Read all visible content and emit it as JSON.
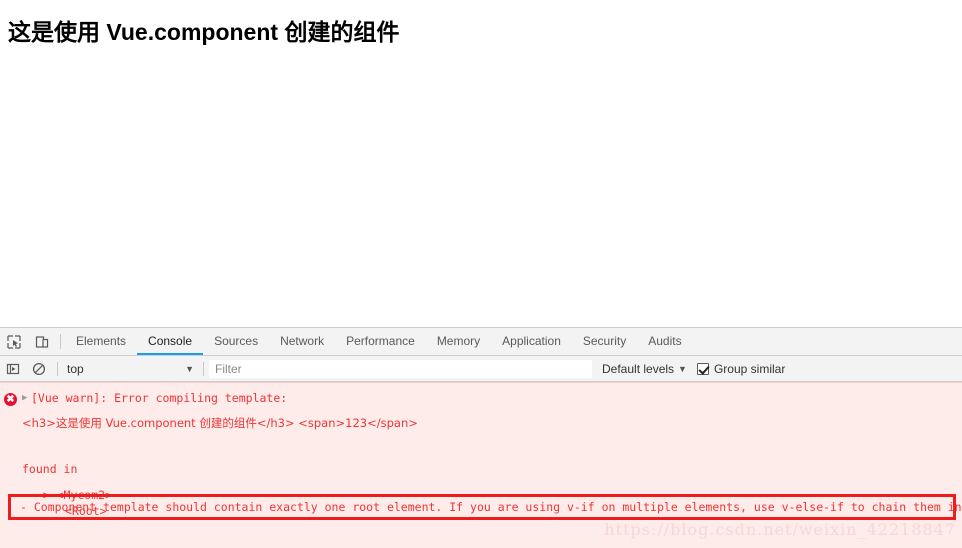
{
  "page": {
    "heading": "这是使用 Vue.component 创建的组件"
  },
  "devtools": {
    "icons": {
      "inspect": "inspect-element-icon",
      "device": "device-toolbar-icon",
      "execution_context": "execution-context-icon",
      "clear_console": "clear-console-icon"
    },
    "tabs": [
      {
        "label": "Elements",
        "active": false
      },
      {
        "label": "Console",
        "active": true
      },
      {
        "label": "Sources",
        "active": false
      },
      {
        "label": "Network",
        "active": false
      },
      {
        "label": "Performance",
        "active": false
      },
      {
        "label": "Memory",
        "active": false
      },
      {
        "label": "Application",
        "active": false
      },
      {
        "label": "Security",
        "active": false
      },
      {
        "label": "Audits",
        "active": false
      }
    ],
    "active_tab": "Console",
    "accent_color": "#1a9cf0",
    "filterbar": {
      "context": "top",
      "context_caret": "▼",
      "filter_value": "",
      "filter_placeholder": "Filter",
      "levels_label": "Default levels",
      "levels_caret": "▼",
      "group_similar_label": "Group similar",
      "group_similar_checked": true
    },
    "console": {
      "error_icon_glyph": "✖",
      "disclosure_glyph": "▶",
      "error_color": "#f03434",
      "error_bg": "#fdecea",
      "messages": {
        "line1": "[Vue warn]: Error compiling template:",
        "line2": "<h3>这是使用 Vue.component 创建的组件</h3> <span>123</span>",
        "line3": "found in",
        "line4": "---> <Mycom2>",
        "line5": "<Root>"
      },
      "highlighted_message": "- Component template should contain exactly one root element. If you are using v-if on multiple elements, use v-else-if to chain them instead",
      "annotation_color": "#ee1c1c"
    }
  },
  "watermark": {
    "text": "https://blog.csdn.net/weixin_42218847"
  }
}
